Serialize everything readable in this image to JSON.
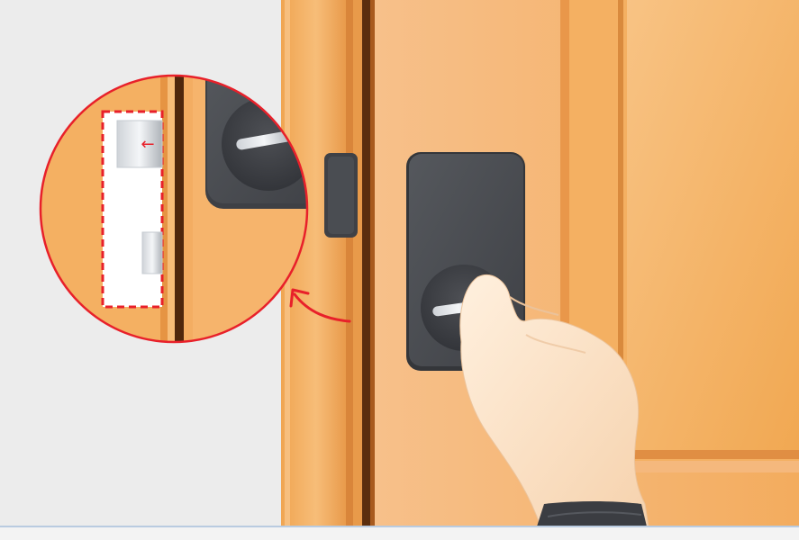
{
  "illustration": {
    "subject": "door-lock-installation-step",
    "colors": {
      "wall": "#ececec",
      "door": "#f4b062",
      "door_light": "#f8c58a",
      "frame": "#e9953f",
      "frame_dark": "#8a4a17",
      "lock_body": "#4a4c51",
      "lock_body_light": "#5c5f64",
      "highlight": "#e8202a",
      "skin": "#fde2c6",
      "sleeve": "#3b3d42"
    },
    "magnifier_arrow_glyph": "←",
    "icons": [
      "magnifier-callout",
      "direction-arrow",
      "curved-pointer-arrow",
      "hand"
    ]
  }
}
